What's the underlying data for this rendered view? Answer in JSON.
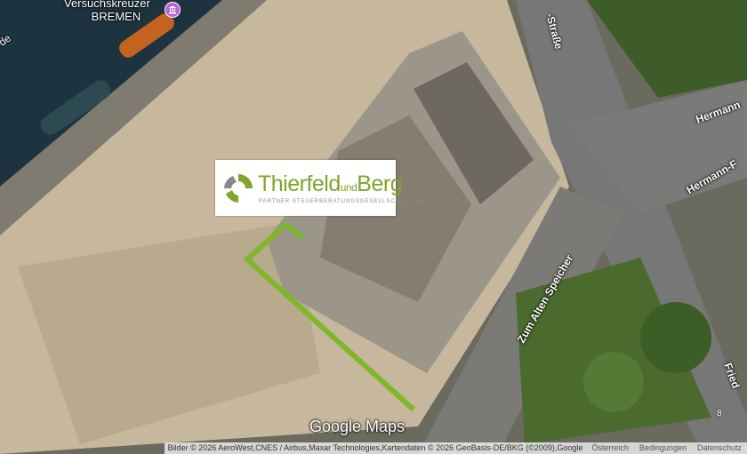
{
  "map": {
    "poi": {
      "line1": "Versuchskreuzer",
      "line2": "BREMEN",
      "icon": "museum-icon"
    },
    "streets": {
      "strasse_top": "-Straße",
      "hermann_1": "Hermann",
      "hermann_2": "Hermann-F",
      "zum_alten_speicher": "Zum Alten Speicher",
      "fried": "Fried",
      "partial_left": "de"
    },
    "marker": {
      "name": "Thierfeld",
      "connector": "und",
      "name2": "Berg",
      "subtitle": "PARTNER STEUERBERATUNGSGESELLSCHAFT MBB",
      "accent": "#7fa52a"
    },
    "route_color": "#7fb72a",
    "corner_number": "8"
  },
  "branding": {
    "google_maps": "Google Maps"
  },
  "attribution": {
    "text": "Bilder © 2026 AeroWest,CNES / Airbus,Maxar Technologies,Kartendaten © 2026 GeoBasis-DE/BKG (©2009),Google",
    "country": "Österreich",
    "terms": "Bedingungen",
    "privacy": "Datenschutz"
  }
}
